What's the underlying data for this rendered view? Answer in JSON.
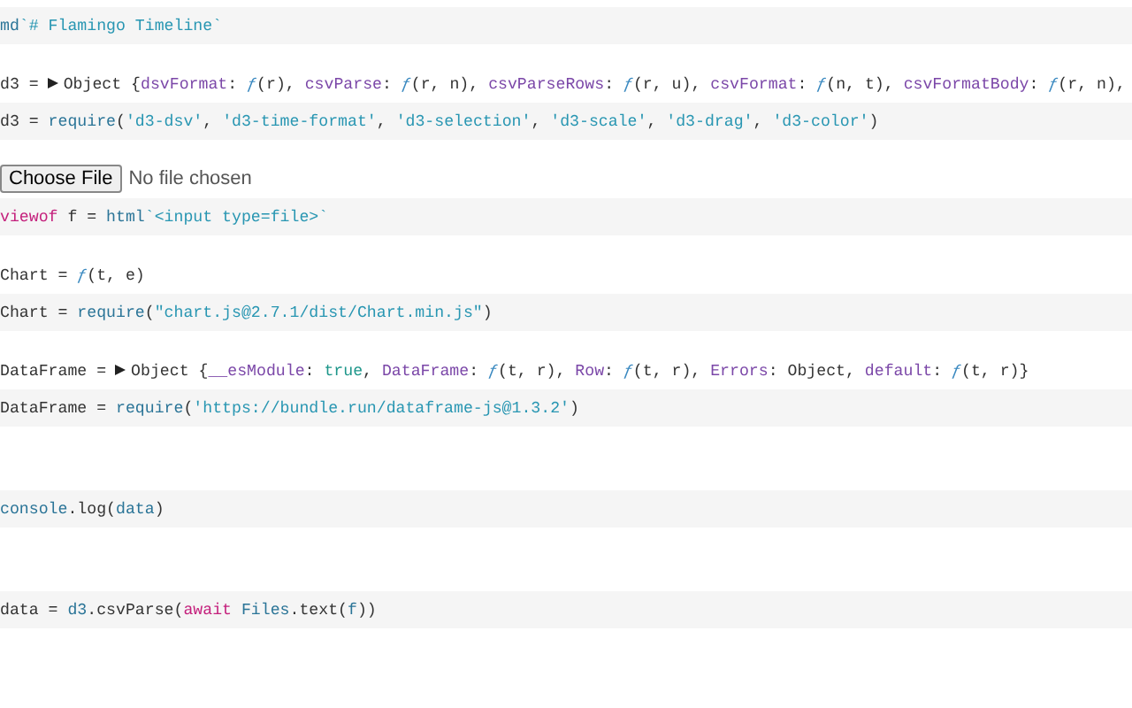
{
  "cells": [
    {
      "code": [
        {
          "text": "md",
          "kind": "builtin"
        },
        {
          "text": "`# Flamingo Timeline`",
          "kind": "string"
        }
      ]
    },
    {
      "output": {
        "kind": "object",
        "name": "d3 =",
        "expanded": false,
        "value": [
          {
            "text": "Object {",
            "kind": "plain"
          },
          {
            "text": "dsvFormat",
            "kind": "property"
          },
          {
            "text": ": ",
            "kind": "plain"
          },
          {
            "text": "ƒ",
            "kind": "func"
          },
          {
            "text": "(r), ",
            "kind": "plain"
          },
          {
            "text": "csvParse",
            "kind": "property"
          },
          {
            "text": ": ",
            "kind": "plain"
          },
          {
            "text": "ƒ",
            "kind": "func"
          },
          {
            "text": "(r, n), ",
            "kind": "plain"
          },
          {
            "text": "csvParseRows",
            "kind": "property"
          },
          {
            "text": ": ",
            "kind": "plain"
          },
          {
            "text": "ƒ",
            "kind": "func"
          },
          {
            "text": "(r, u), ",
            "kind": "plain"
          },
          {
            "text": "csvFormat",
            "kind": "property"
          },
          {
            "text": ": ",
            "kind": "plain"
          },
          {
            "text": "ƒ",
            "kind": "func"
          },
          {
            "text": "(n, t), ",
            "kind": "plain"
          },
          {
            "text": "csvFormatBody",
            "kind": "property"
          },
          {
            "text": ": ",
            "kind": "plain"
          },
          {
            "text": "ƒ",
            "kind": "func"
          },
          {
            "text": "(r, n),",
            "kind": "plain"
          }
        ]
      },
      "code": [
        {
          "text": "d3 = ",
          "kind": "plain"
        },
        {
          "text": "require",
          "kind": "builtin"
        },
        {
          "text": "(",
          "kind": "plain"
        },
        {
          "text": "'d3-dsv'",
          "kind": "string"
        },
        {
          "text": ", ",
          "kind": "plain"
        },
        {
          "text": "'d3-time-format'",
          "kind": "string"
        },
        {
          "text": ", ",
          "kind": "plain"
        },
        {
          "text": "'d3-selection'",
          "kind": "string"
        },
        {
          "text": ", ",
          "kind": "plain"
        },
        {
          "text": "'d3-scale'",
          "kind": "string"
        },
        {
          "text": ", ",
          "kind": "plain"
        },
        {
          "text": "'d3-drag'",
          "kind": "string"
        },
        {
          "text": ", ",
          "kind": "plain"
        },
        {
          "text": "'d3-color'",
          "kind": "string"
        },
        {
          "text": ")",
          "kind": "plain"
        }
      ]
    },
    {
      "output": {
        "kind": "file",
        "button": "Choose File",
        "status": "No file chosen"
      },
      "code": [
        {
          "text": "viewof",
          "kind": "keyword"
        },
        {
          "text": " f = ",
          "kind": "plain"
        },
        {
          "text": "html",
          "kind": "builtin"
        },
        {
          "text": "`<input type=file>`",
          "kind": "string"
        }
      ]
    },
    {
      "output": {
        "kind": "value",
        "name": "Chart =",
        "value": [
          {
            "text": "ƒ",
            "kind": "func"
          },
          {
            "text": "(t, e)",
            "kind": "plain"
          }
        ]
      },
      "code": [
        {
          "text": "Chart = ",
          "kind": "plain"
        },
        {
          "text": "require",
          "kind": "builtin"
        },
        {
          "text": "(",
          "kind": "plain"
        },
        {
          "text": "\"chart.js@2.7.1/dist/Chart.min.js\"",
          "kind": "string"
        },
        {
          "text": ")",
          "kind": "plain"
        }
      ]
    },
    {
      "output": {
        "kind": "object",
        "name": "DataFrame =",
        "expanded": false,
        "value": [
          {
            "text": "Object {",
            "kind": "plain"
          },
          {
            "text": "__esModule",
            "kind": "property"
          },
          {
            "text": ": ",
            "kind": "plain"
          },
          {
            "text": "true",
            "kind": "boolean"
          },
          {
            "text": ", ",
            "kind": "plain"
          },
          {
            "text": "DataFrame",
            "kind": "property"
          },
          {
            "text": ": ",
            "kind": "plain"
          },
          {
            "text": "ƒ",
            "kind": "func"
          },
          {
            "text": "(t, r), ",
            "kind": "plain"
          },
          {
            "text": "Row",
            "kind": "property"
          },
          {
            "text": ": ",
            "kind": "plain"
          },
          {
            "text": "ƒ",
            "kind": "func"
          },
          {
            "text": "(t, r), ",
            "kind": "plain"
          },
          {
            "text": "Errors",
            "kind": "property"
          },
          {
            "text": ": Object, ",
            "kind": "plain"
          },
          {
            "text": "default",
            "kind": "property"
          },
          {
            "text": ": ",
            "kind": "plain"
          },
          {
            "text": "ƒ",
            "kind": "func"
          },
          {
            "text": "(t, r)}",
            "kind": "plain"
          }
        ]
      },
      "code": [
        {
          "text": "DataFrame = ",
          "kind": "plain"
        },
        {
          "text": "require",
          "kind": "builtin"
        },
        {
          "text": "(",
          "kind": "plain"
        },
        {
          "text": "'https://bundle.run/dataframe-js@1.3.2'",
          "kind": "string"
        },
        {
          "text": ")",
          "kind": "plain"
        }
      ]
    },
    {
      "output": {
        "kind": "empty"
      },
      "code": [
        {
          "text": "console",
          "kind": "builtin"
        },
        {
          "text": ".log(",
          "kind": "plain"
        },
        {
          "text": "data",
          "kind": "builtin"
        },
        {
          "text": ")",
          "kind": "plain"
        }
      ]
    },
    {
      "output": {
        "kind": "empty"
      },
      "code": [
        {
          "text": "data = ",
          "kind": "plain"
        },
        {
          "text": "d3",
          "kind": "builtin"
        },
        {
          "text": ".csvParse(",
          "kind": "plain"
        },
        {
          "text": "await ",
          "kind": "keyword"
        },
        {
          "text": "Files",
          "kind": "builtin"
        },
        {
          "text": ".text(",
          "kind": "plain"
        },
        {
          "text": "f",
          "kind": "builtin"
        },
        {
          "text": "))",
          "kind": "plain"
        }
      ]
    }
  ]
}
